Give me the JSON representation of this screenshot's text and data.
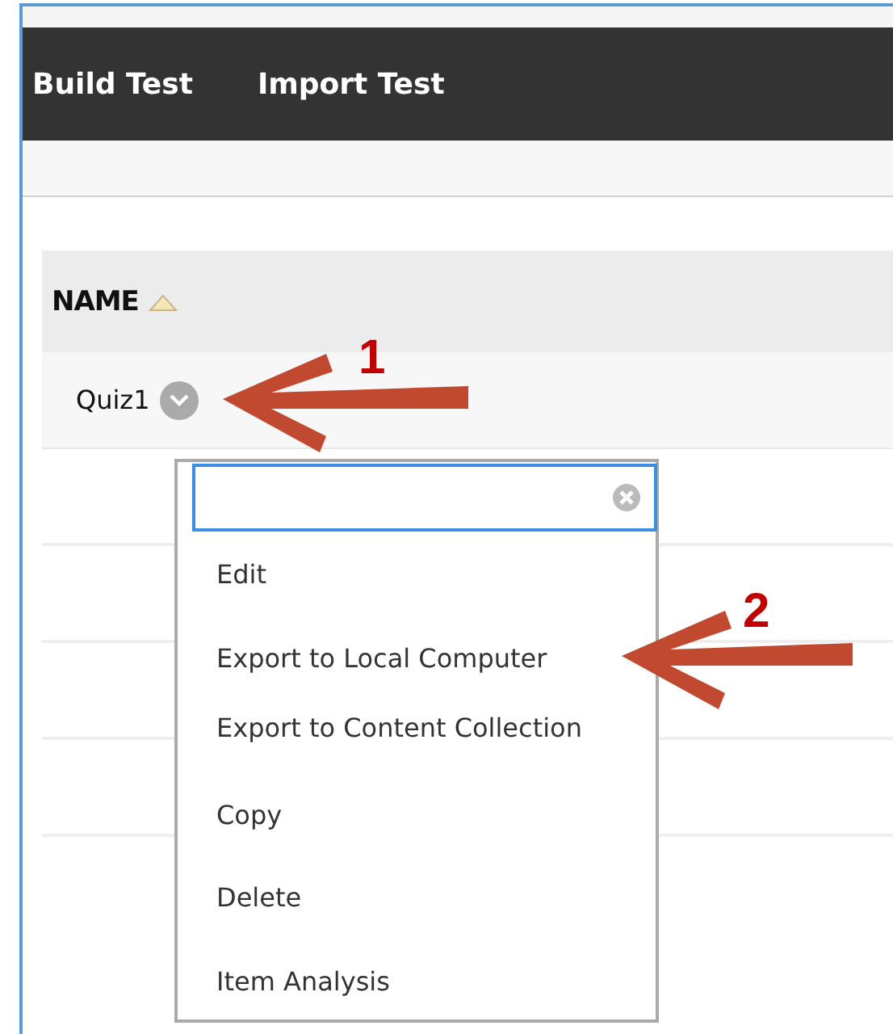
{
  "nav_bar": {
    "items": [
      {
        "label": "Build Test"
      },
      {
        "label": "Import Test"
      }
    ]
  },
  "table": {
    "columns": [
      {
        "label": "NAME",
        "sorted": true
      }
    ],
    "rows": [
      {
        "name": "Quiz1"
      }
    ]
  },
  "context_menu": {
    "items": [
      {
        "label": "Edit"
      },
      {
        "label": "Export to Local Computer"
      },
      {
        "label": "Export to Content Collection"
      },
      {
        "label": "Copy"
      },
      {
        "label": "Delete"
      },
      {
        "label": "Item Analysis"
      }
    ]
  },
  "annotations": [
    {
      "label": "1"
    },
    {
      "label": "2"
    }
  ]
}
